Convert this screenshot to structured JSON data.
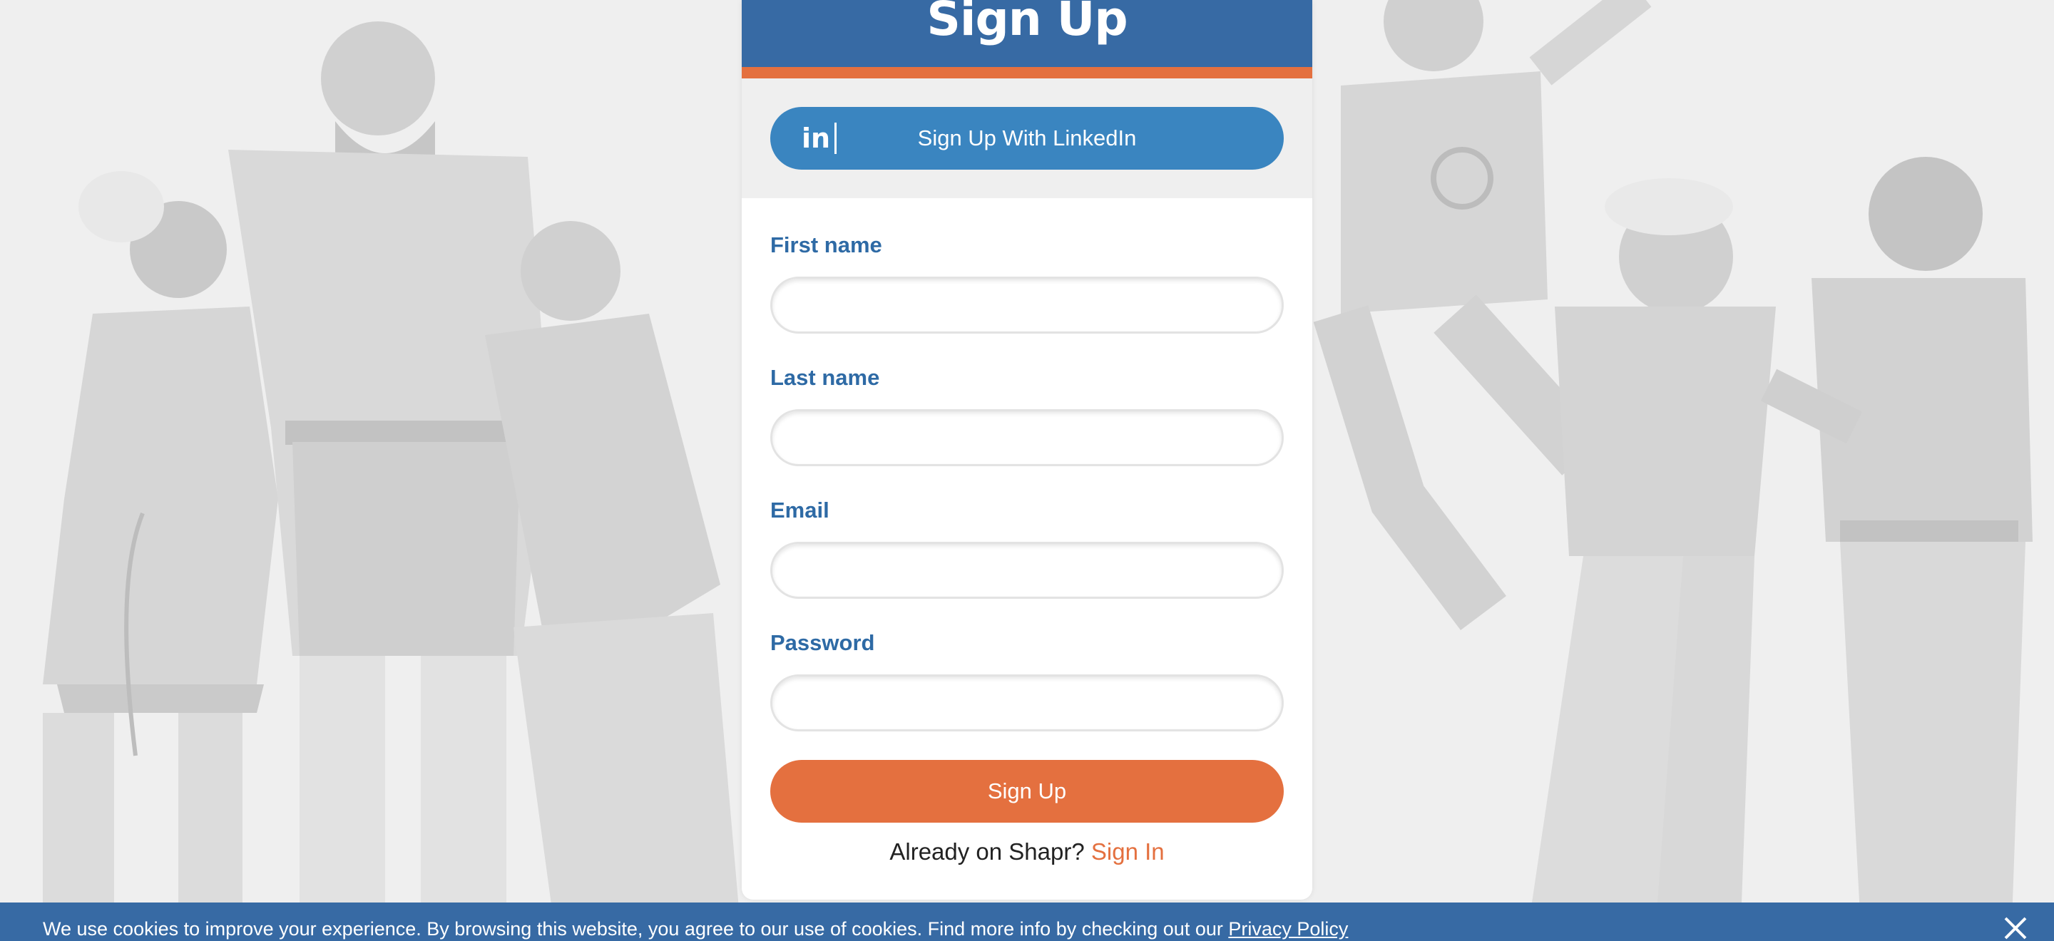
{
  "page": {
    "title": "Sign Up"
  },
  "social": {
    "linkedin_icon": "in",
    "linkedin_label": "Sign Up With LinkedIn"
  },
  "form": {
    "first_name_label": "First name",
    "last_name_label": "Last name",
    "email_label": "Email",
    "password_label": "Password",
    "first_name_value": "",
    "last_name_value": "",
    "email_value": "",
    "password_value": "",
    "submit_label": "Sign Up"
  },
  "signin": {
    "prompt": "Already on Shapr?",
    "link_label": "Sign In"
  },
  "cookie": {
    "message": "We use cookies to improve your experience. By browsing this website, you agree to our use of cookies. Find more info by checking out our",
    "link_label": "Privacy Policy",
    "close_icon": "close-icon"
  },
  "colors": {
    "brand_blue": "#376aa4",
    "linkedin_blue": "#3a85c0",
    "accent_orange": "#e4703f",
    "background": "#efefef"
  }
}
